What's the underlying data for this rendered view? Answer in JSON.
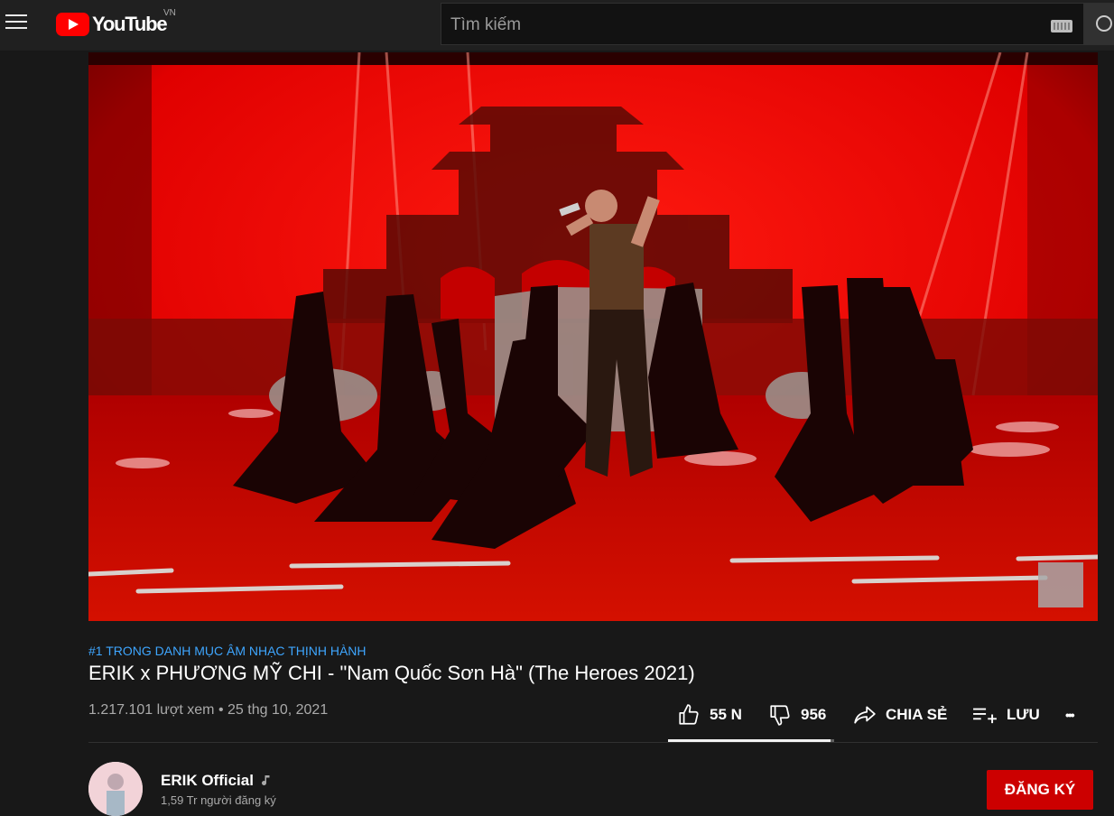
{
  "header": {
    "logo_text": "YouTube",
    "country_code": "VN",
    "search_placeholder": "Tìm kiếm"
  },
  "video": {
    "super_title": "#1 TRONG DANH MỤC ÂM NHẠC THỊNH HÀNH",
    "title": "ERIK x PHƯƠNG MỸ CHI - \"Nam Quốc Sơn Hà\" (The Heroes 2021)",
    "views": "1.217.101 lượt xem",
    "separator": "•",
    "date": "25 thg 10, 2021"
  },
  "actions": {
    "like_count": "55 N",
    "dislike_count": "956",
    "share_label": "CHIA SẺ",
    "save_label": "LƯU",
    "more_label": "•••",
    "like_ratio": 0.98
  },
  "channel": {
    "name": "ERIK Official",
    "subscribers": "1,59 Tr người đăng ký",
    "subscribe_label": "ĐĂNG KÝ"
  },
  "colors": {
    "background": "#181818",
    "header": "#202020",
    "accent_link": "#3ea6ff",
    "subscribe": "#cc0000",
    "stage_red": "#e00000"
  },
  "icons": {
    "menu": "hamburger-icon",
    "logo": "youtube-logo-icon",
    "keyboard": "keyboard-icon",
    "search": "search-icon",
    "like": "thumb-up-icon",
    "dislike": "thumb-down-icon",
    "share": "share-icon",
    "save": "playlist-add-icon",
    "more": "more-horizontal-icon",
    "music": "music-note-icon"
  }
}
